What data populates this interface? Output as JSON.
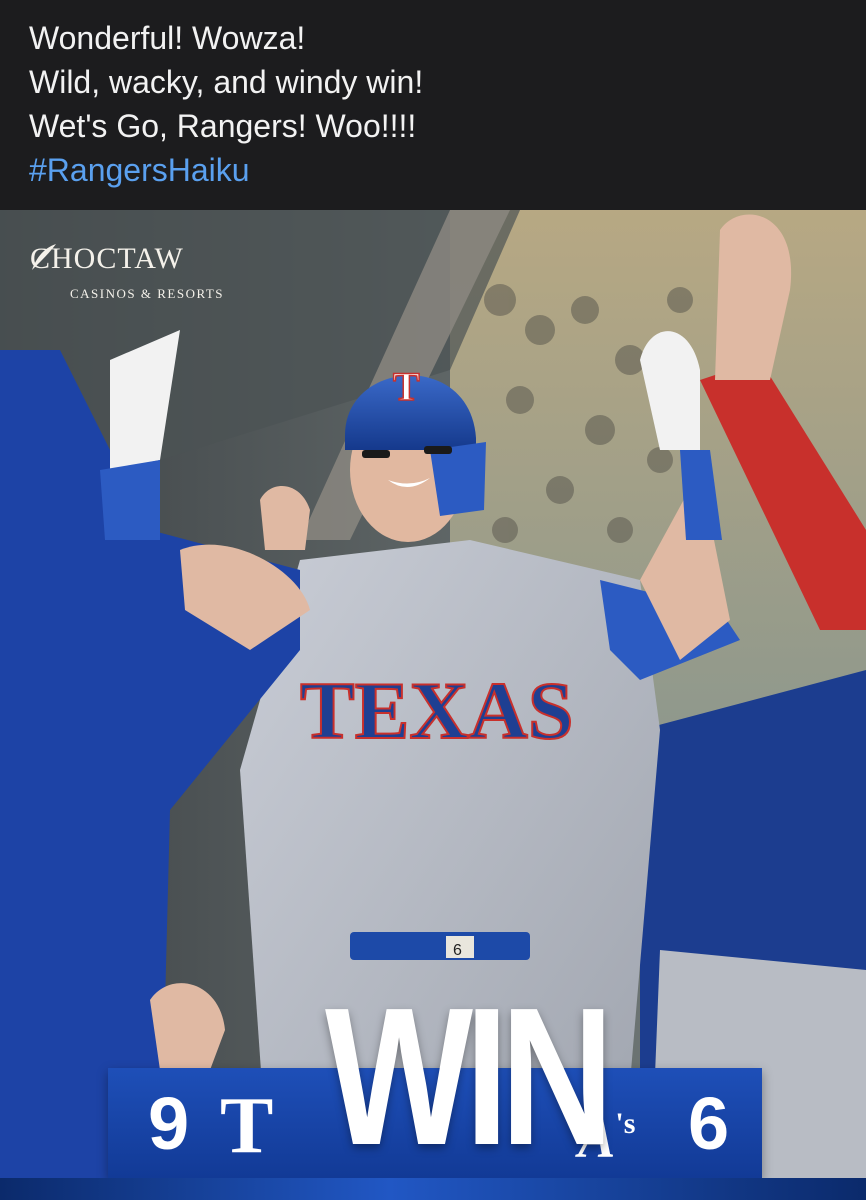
{
  "post": {
    "lines": [
      "Wonderful! Wowza!",
      "Wild, wacky, and windy win!",
      "Wet's Go, Rangers! Woo!!!!"
    ],
    "hashtag": "#RangersHaiku"
  },
  "graphic": {
    "sponsor": {
      "name": "CHOCTAW",
      "tagline": "CASINOS & RESORTS"
    },
    "jersey_text": "TEXAS",
    "helmet_letter": "T",
    "belt_number": "6",
    "headline": "WIN",
    "score": {
      "home_runs": "9",
      "home_logo": "T",
      "away_runs": "6",
      "away_logo": "A",
      "away_logo_suffix": "'s"
    },
    "colors": {
      "rangers_blue": "#1e4fb8",
      "rangers_red": "#c8302c",
      "background": "#1c1c1e",
      "hashtag_link": "#5aa0ef"
    }
  }
}
